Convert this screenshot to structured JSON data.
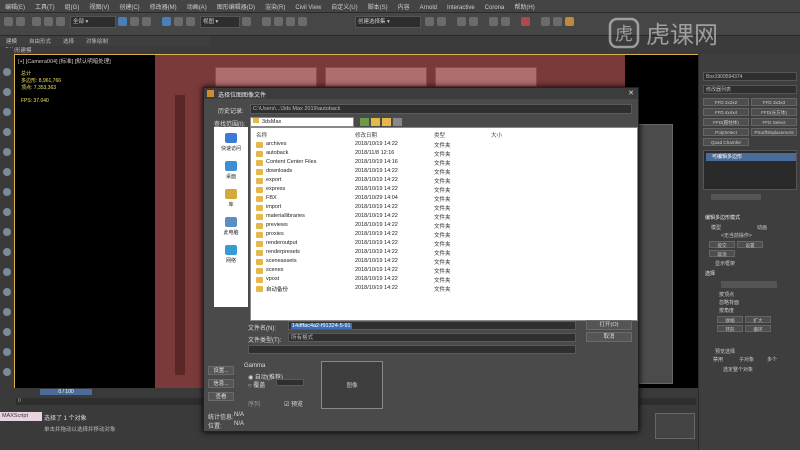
{
  "menu": [
    "编辑(E)",
    "工具(T)",
    "组(G)",
    "视图(V)",
    "创建(C)",
    "修改器(M)",
    "动画(A)",
    "图形编辑器(D)",
    "渲染(R)",
    "Civil View",
    "自定义(U)",
    "脚本(S)",
    "内容",
    "Arnold",
    "Interactive",
    "Corona",
    "帮助(H)"
  ],
  "toolbar": {
    "view_select": "视图",
    "selection_set": "创建选择集"
  },
  "ribbon": [
    "建模",
    "自由形式",
    "选择",
    "对象绘制"
  ],
  "ribbon_sub": "多边形建模",
  "viewport": {
    "label": "[+] [Camera004] [标准] [默认明暗处理]",
    "stats_title": "总计",
    "polys": "多边形: 8,961,766",
    "verts": "顶点: 7,353,363",
    "fps": "FPS:    37.040"
  },
  "dialog": {
    "title": "选择位图图像文件",
    "history_label": "历史记录:",
    "history_value": "C:\\Users\\...\\3ds Max 2019\\autoback",
    "lookin_label": "查找范围(I):",
    "lookin_value": "3dsMax",
    "sidebar": [
      "快速访问",
      "桌面",
      "库",
      "此电脑",
      "网络"
    ],
    "columns": {
      "name": "名称",
      "date": "修改日期",
      "type": "类型",
      "size": "大小"
    },
    "files": [
      {
        "name": "archives",
        "date": "2018/10/19 14:22",
        "type": "文件夹"
      },
      {
        "name": "autoback",
        "date": "2018/11/8 12:16",
        "type": "文件夹"
      },
      {
        "name": "Content Center Files",
        "date": "2018/10/19 14:16",
        "type": "文件夹"
      },
      {
        "name": "downloads",
        "date": "2018/10/19 14:22",
        "type": "文件夹"
      },
      {
        "name": "export",
        "date": "2018/10/19 14:22",
        "type": "文件夹"
      },
      {
        "name": "express",
        "date": "2018/10/19 14:22",
        "type": "文件夹"
      },
      {
        "name": "FBX",
        "date": "2018/10/29 14:04",
        "type": "文件夹"
      },
      {
        "name": "import",
        "date": "2018/10/19 14:22",
        "type": "文件夹"
      },
      {
        "name": "materiallibraries",
        "date": "2018/10/19 14:22",
        "type": "文件夹"
      },
      {
        "name": "previews",
        "date": "2018/10/19 14:22",
        "type": "文件夹"
      },
      {
        "name": "proxies",
        "date": "2018/10/19 14:22",
        "type": "文件夹"
      },
      {
        "name": "renderoutput",
        "date": "2018/10/19 14:22",
        "type": "文件夹"
      },
      {
        "name": "renderpresets",
        "date": "2018/10/19 14:22",
        "type": "文件夹"
      },
      {
        "name": "sceneassets",
        "date": "2018/10/19 14:22",
        "type": "文件夹"
      },
      {
        "name": "scenes",
        "date": "2018/10/19 14:22",
        "type": "文件夹"
      },
      {
        "name": "vpost",
        "date": "2018/10/19 14:22",
        "type": "文件夹"
      },
      {
        "name": "自动备份",
        "date": "2018/10/19 14:22",
        "type": "文件夹"
      }
    ],
    "filename_label": "文件名(N):",
    "filename_value": "14dffac4a2-f91324-5-91",
    "filetype_label": "文件类型(T):",
    "filetype_value": "所有格式",
    "open_button": "打开(O)",
    "cancel_button": "取消",
    "gamma_title": "Gamma",
    "gamma_auto": "自动(推荐)",
    "gamma_override": "覆盖",
    "sequence": "序列",
    "preview_chk": "预览",
    "preview_label": "图像",
    "stats_label": "统计信息:",
    "stats_value": "N/A",
    "location_label": "位置:",
    "location_value": "N/A",
    "setup_btn": "设置...",
    "info_btn": "信息...",
    "view_btn": "查看"
  },
  "right_panel": {
    "object_name": "Box1909594374",
    "modifier_list": "修改器列表",
    "btns": [
      "FFD 2x2x2",
      "FFD 3x3x3",
      "FFD 4x4x4",
      "FFD(长方体)",
      "FFD(圆柱体)",
      "FFD Select",
      "PolySelect",
      "PSurfDisplacement",
      "Quad Chamfer"
    ],
    "stack_item": "可编辑多边形",
    "section_edit": "编辑多边形模式",
    "model_label": "模型",
    "anim_label": "动画",
    "no_op": "<无当前操作>",
    "commit": "提交",
    "settings": "设置",
    "cancel": "取消",
    "show_cage": "显示框架",
    "section_select": "选择",
    "subsel": "按顶点",
    "ignore_back": "忽略背面",
    "by_angle": "按角度",
    "shrink": "收缩",
    "grow": "扩大",
    "ring": "环形",
    "loop": "循环",
    "preview_sel": "预览选择",
    "off": "禁用",
    "subobj": "子对象",
    "multi": "多个",
    "selected": "选定整个对象"
  },
  "status": {
    "maxscript": "MAXScript",
    "selected": "选择了 1 个对象",
    "hint": "单击并拖动以选择并移动对象",
    "frames": "0 / 100",
    "timeline_mark": "0"
  },
  "logo": "虎课网"
}
